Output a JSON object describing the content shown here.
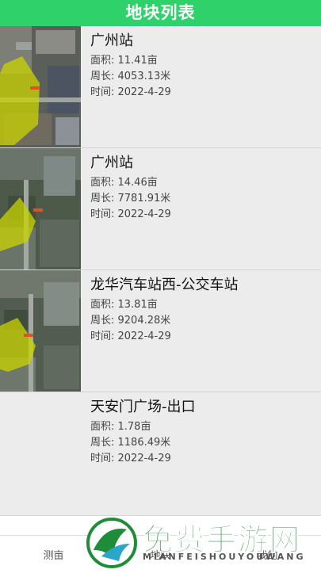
{
  "header": {
    "title": "地块列表"
  },
  "plots": [
    {
      "name": "广州站",
      "area": "面积: 11.41亩",
      "perimeter": "周长: 4053.13米",
      "time": "时间: 2022-4-29"
    },
    {
      "name": "广州站",
      "area": "面积: 14.46亩",
      "perimeter": "周长: 7781.91米",
      "time": "时间: 2022-4-29"
    },
    {
      "name": "龙华汽车站西-公交车站",
      "area": "面积: 13.81亩",
      "perimeter": "周长: 9204.28米",
      "time": "时间: 2022-4-29"
    },
    {
      "name": "天安门广场-出口",
      "area": "面积: 1.78亩",
      "perimeter": "周长: 1186.49米",
      "time": "时间: 2022-4-29"
    }
  ],
  "nav": {
    "tabs": [
      "测亩",
      "地块",
      "我的"
    ]
  },
  "watermark": {
    "text": "免费手游网",
    "sub": "MIANFEISHOUYOUWANG"
  },
  "colors": {
    "header": "#2fd16a",
    "polygon": "#c9d400"
  }
}
